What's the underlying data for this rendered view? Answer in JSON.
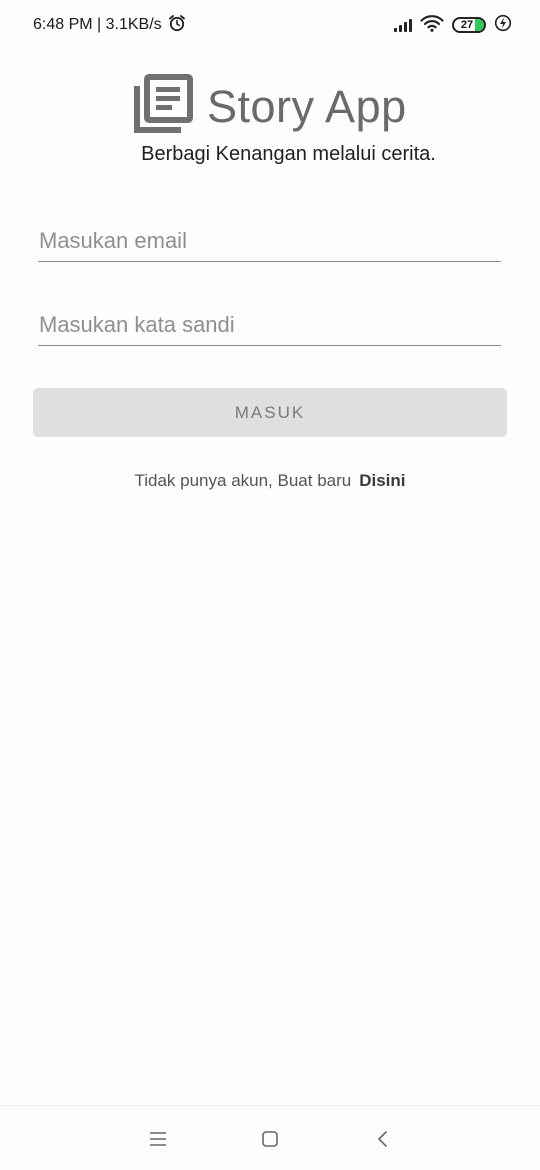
{
  "status_bar": {
    "time_speed": "6:48 PM | 3.1KB/s",
    "battery_level": "27",
    "icons": [
      "alarm-icon",
      "signal-icon",
      "wifi-icon",
      "battery-icon",
      "charging-icon"
    ]
  },
  "header": {
    "app_title": "Story App",
    "tagline": "Berbagi Kenangan melalui cerita.",
    "logo_icon": "news-icon"
  },
  "form": {
    "email_placeholder": "Masukan email",
    "email_value": "",
    "password_placeholder": "Masukan kata sandi",
    "password_value": "",
    "login_label": "MASUK"
  },
  "register": {
    "text": "Tidak punya akun, Buat baru",
    "link": "Disini"
  },
  "nav": {
    "icons": [
      "menu-icon",
      "home-icon",
      "back-icon"
    ]
  },
  "colors": {
    "background": "#fdfdfd",
    "button_disabled": "#dfdfdf",
    "battery_fill": "#33c759"
  }
}
